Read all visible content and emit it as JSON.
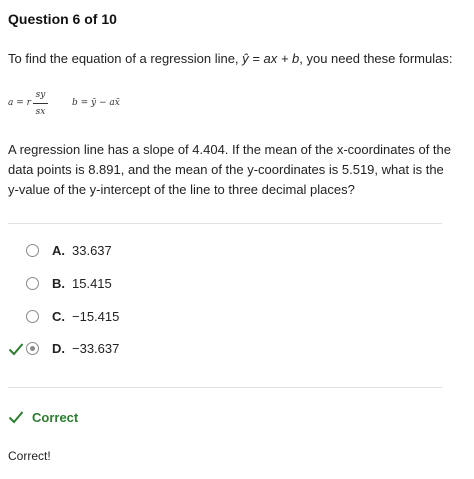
{
  "question": {
    "header": "Question 6 of 10",
    "intro_before_eq": "To find the equation of a regression line, ",
    "intro_equation": "ŷ = ax + b",
    "intro_after_eq": ", you need these formulas:",
    "formula_a_lhs": "a = r",
    "formula_a_num": "sy",
    "formula_a_den": "sx",
    "formula_b": "b = ȳ − ax̄",
    "text_line1": "A regression line has a slope of 4.404. If the mean of the x-coordinates of the",
    "text_line2": "data points is 8.891, and the mean of the y-coordinates is 5.519, what is the",
    "text_line3": "y-value of the y-intercept of the line to three decimal places?"
  },
  "options": [
    {
      "letter": "A.",
      "value": "33.637",
      "selected": false,
      "correct": false
    },
    {
      "letter": "B.",
      "value": "15.415",
      "selected": false,
      "correct": false
    },
    {
      "letter": "C.",
      "value": "−15.415",
      "selected": false,
      "correct": false
    },
    {
      "letter": "D.",
      "value": "−33.637",
      "selected": true,
      "correct": true
    }
  ],
  "feedback": {
    "label": "Correct",
    "message": "Correct!"
  },
  "colors": {
    "correct_green": "#2e7d32",
    "radio_gray": "#8a8a8a",
    "divider": "#e2e2e2"
  },
  "icons": {
    "check": "check-icon",
    "radio": "radio-icon"
  }
}
